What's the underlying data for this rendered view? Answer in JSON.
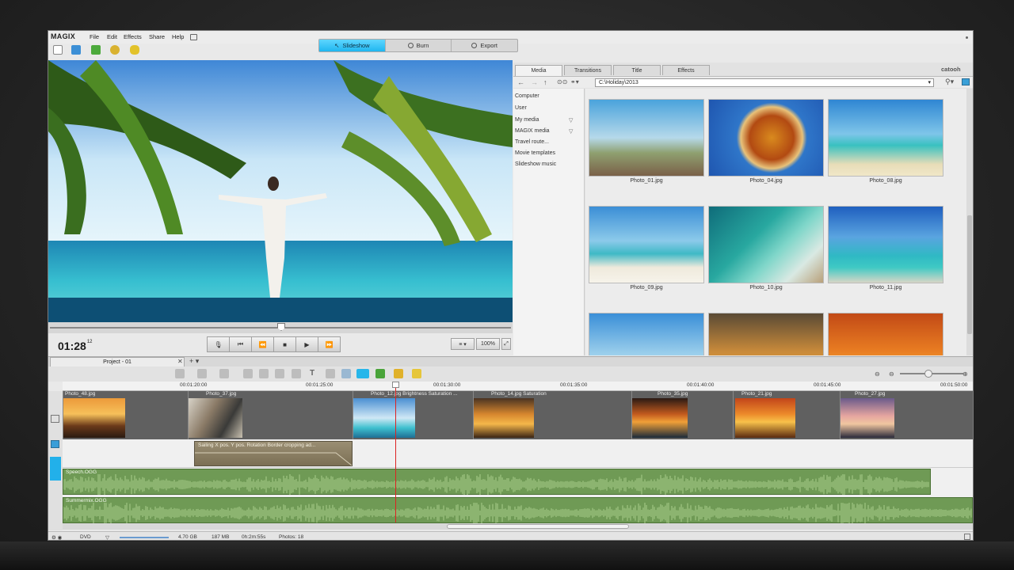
{
  "app": {
    "logo": "MAGIX"
  },
  "menu": [
    "File",
    "Edit",
    "Effects",
    "Share",
    "Help"
  ],
  "modes": {
    "slideshow": "Slideshow",
    "burn": "Burn",
    "export": "Export",
    "active": "slideshow"
  },
  "preview": {
    "timecode": "01:28",
    "frames": "12",
    "zoom": "100%"
  },
  "media_tabs": [
    "Media",
    "Transitions",
    "Title",
    "Effects"
  ],
  "media_tab_active": "Media",
  "brand": "catooh",
  "path": "C:\\Holiday\\2013",
  "tree": [
    "Computer",
    "User",
    "My media",
    "MAGIX media",
    "Travel route...",
    "Movie templates",
    "Slideshow music"
  ],
  "photos": [
    "Photo_01.jpg",
    "Photo_04.jpg",
    "Photo_08.jpg",
    "Photo_09.jpg",
    "Photo_10.jpg",
    "Photo_11.jpg"
  ],
  "project": {
    "tab": "Project - 01"
  },
  "ruler": [
    "00:01:20:00",
    "00:01:25:00",
    "00:01:30:00",
    "00:01:35:00",
    "00:01:40:00",
    "00:01:45:00",
    "00:01:50:00"
  ],
  "clips": [
    {
      "name": "Photo_48.jpg"
    },
    {
      "name": "Photo_37.jpg"
    },
    {
      "name": "Photo_12.jpg  Brightness  Saturation  ..."
    },
    {
      "name": "Photo_14.jpg  Saturation"
    },
    {
      "name": "Photo_35.jpg"
    },
    {
      "name": "Photo_21.jpg"
    },
    {
      "name": "Photo_27.jpg"
    }
  ],
  "fx_clip": "Sailing  X pos.  Y pos.  Rotation  Border cropping ad...",
  "audio": [
    "Speech.OGG",
    "Summermix.OGG"
  ],
  "status": {
    "format": "DVD",
    "capacity": "4.70 GB",
    "used": "187 MB",
    "duration": "0h:2m:55s",
    "photos": "Photos: 18"
  }
}
